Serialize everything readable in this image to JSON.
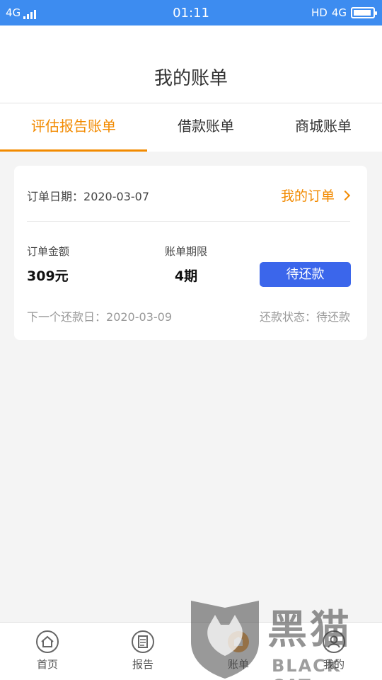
{
  "status_bar": {
    "network_left": "4G",
    "time": "01:11",
    "hd": "HD",
    "network_right": "4G"
  },
  "header": {
    "title": "我的账单"
  },
  "tabs": [
    {
      "label": "评估报告账单",
      "active": true
    },
    {
      "label": "借款账单",
      "active": false
    },
    {
      "label": "商城账单",
      "active": false
    }
  ],
  "card": {
    "order_date_label": "订单日期：",
    "order_date": "2020-03-07",
    "my_order_link": "我的订单",
    "amount_label": "订单金额",
    "amount_value": "309元",
    "term_label": "账单期限",
    "term_value": "4期",
    "pay_button": "待还款",
    "next_due_label": "下一个还款日：",
    "next_due_date": "2020-03-09",
    "status_label": "还款状态：",
    "status_value": "待还款"
  },
  "tab_bar": {
    "items": [
      {
        "label": "首页",
        "icon": "home-icon"
      },
      {
        "label": "报告",
        "icon": "report-icon"
      },
      {
        "label": "账单",
        "icon": "bill-icon",
        "active": true
      },
      {
        "label": "我的",
        "icon": "profile-icon"
      }
    ]
  },
  "watermark": {
    "chinese": "黑猫",
    "latin": "BLACK CAT"
  },
  "colors": {
    "status_bar": "#3d8cf0",
    "accent": "#f28a00",
    "button": "#3b66eb"
  }
}
